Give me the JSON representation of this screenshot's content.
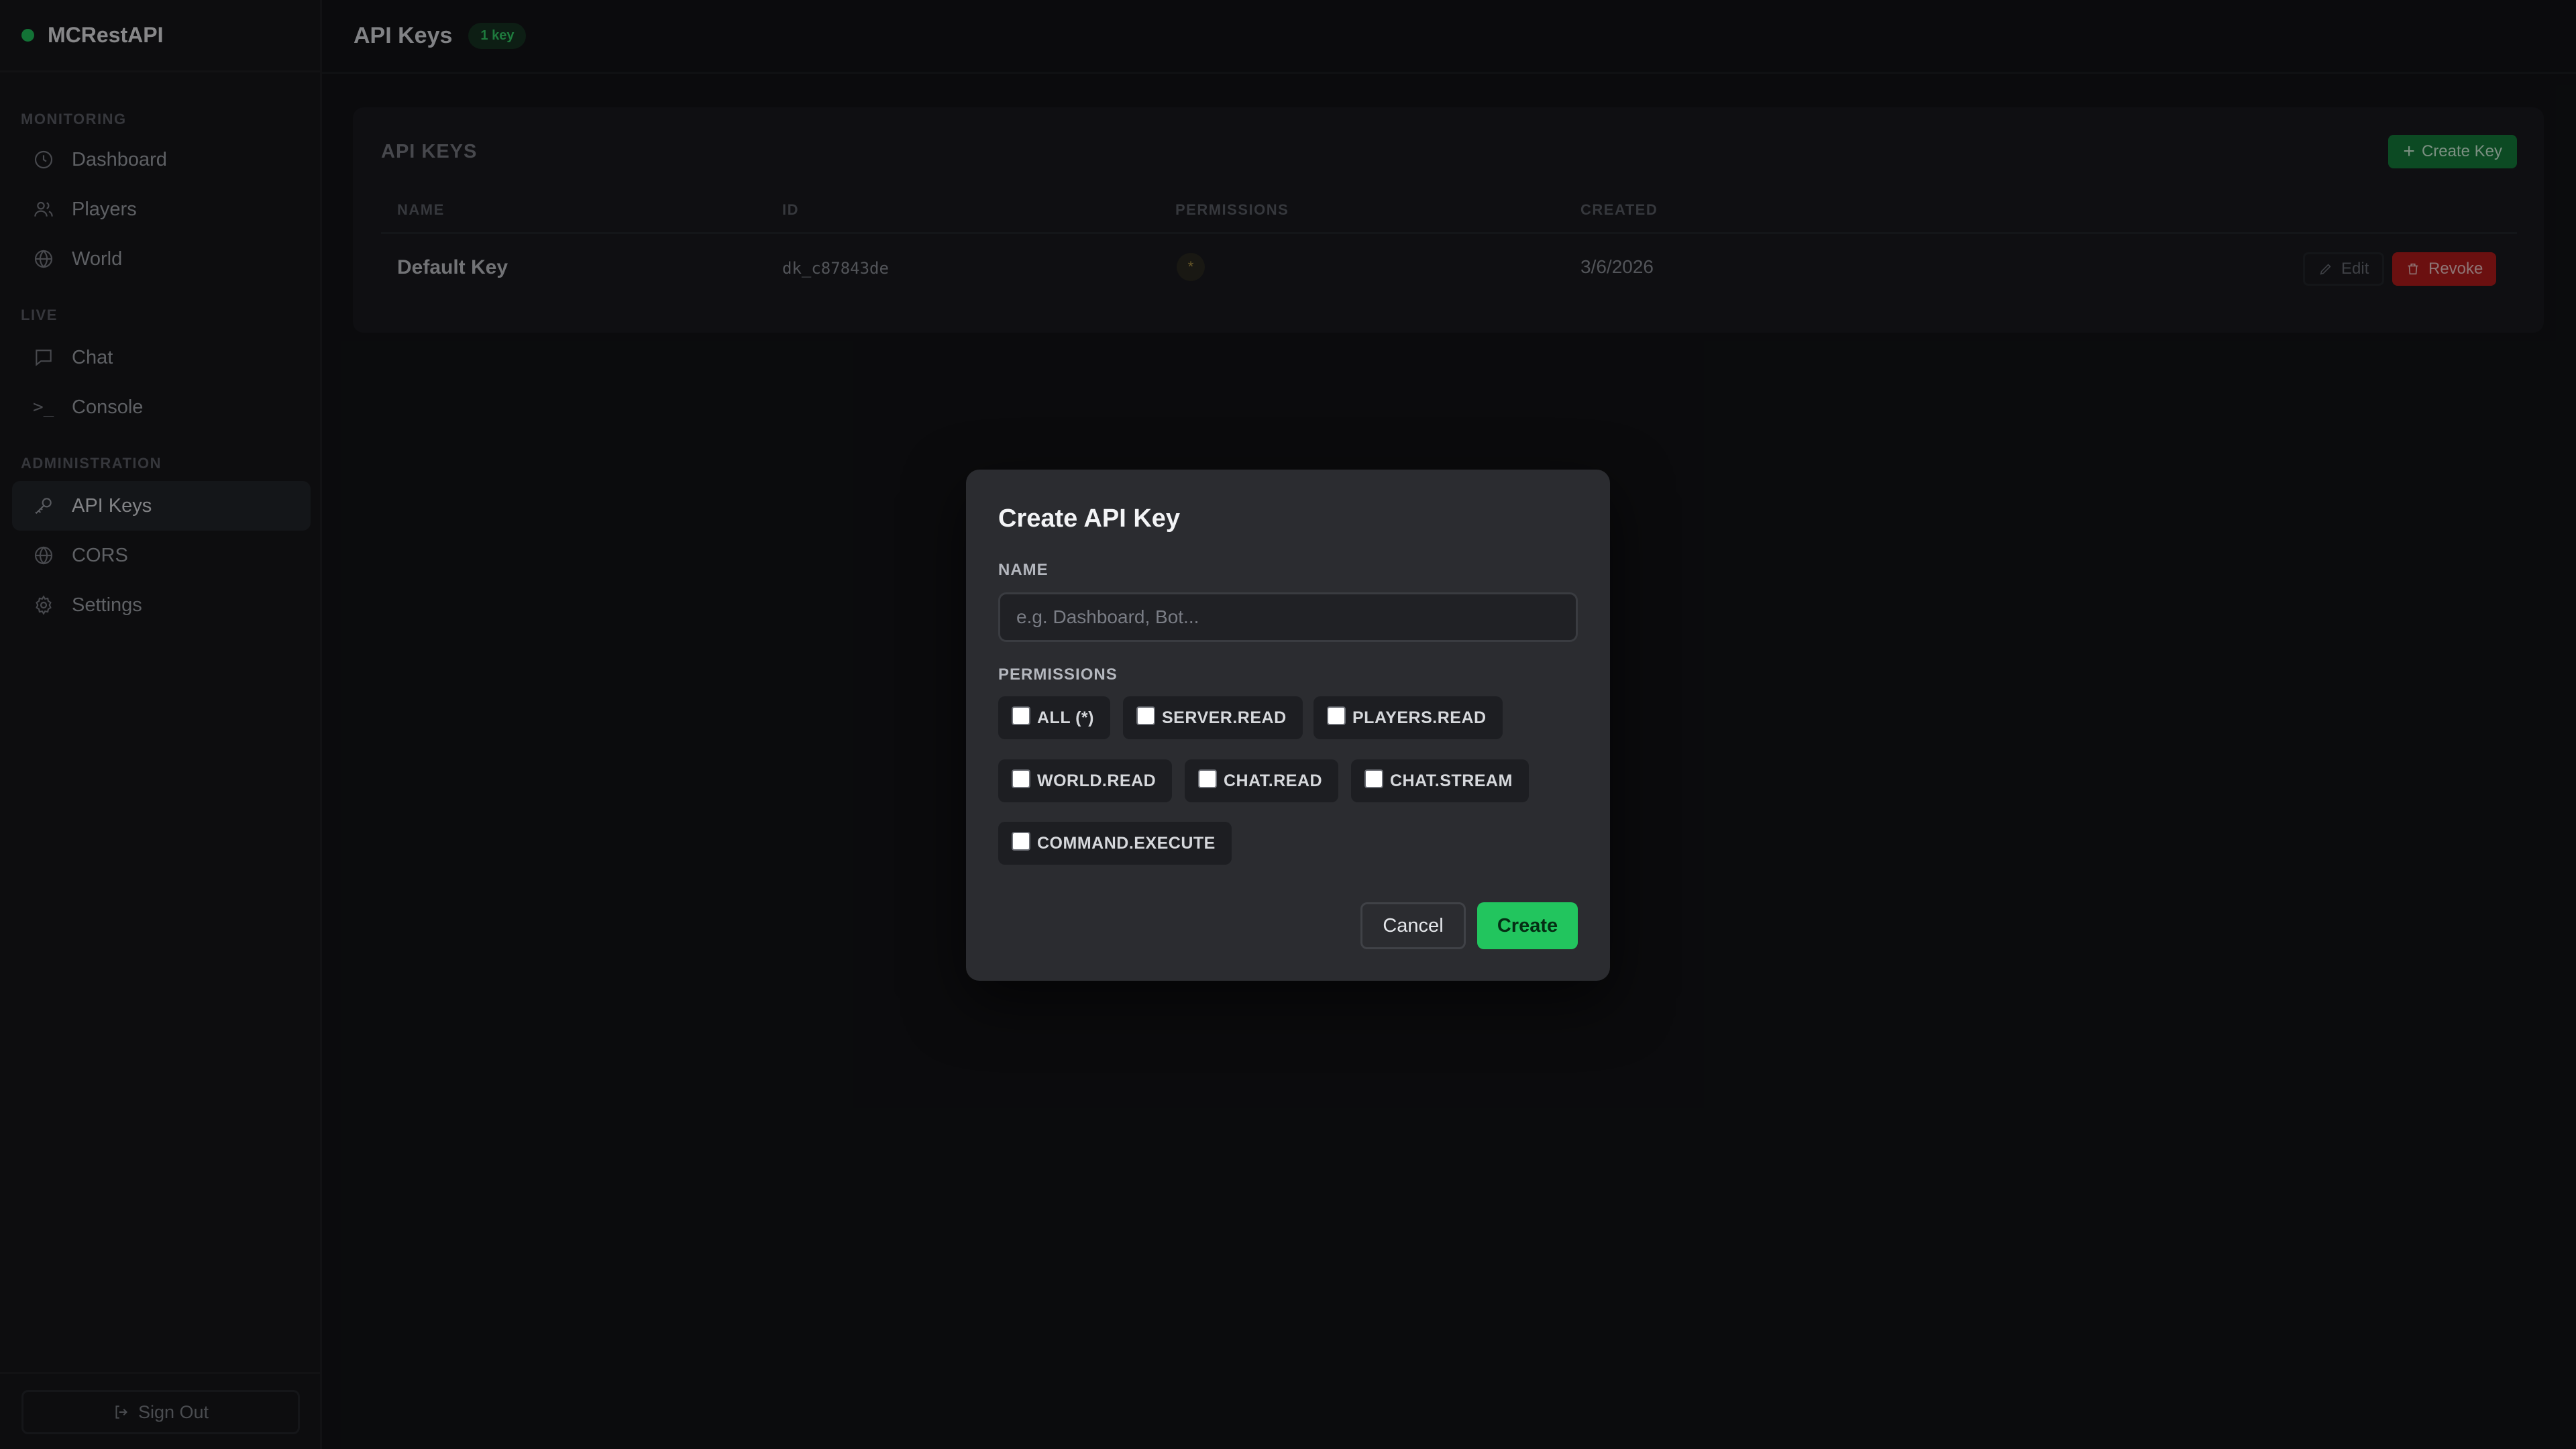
{
  "app": {
    "name": "MCRestAPI",
    "status_color": "#22c55e"
  },
  "sidebar": {
    "sections": [
      {
        "label": "MONITORING"
      },
      {
        "label": "LIVE"
      },
      {
        "label": "ADMINISTRATION"
      }
    ],
    "items": [
      {
        "label": "Dashboard",
        "icon": "clock-icon"
      },
      {
        "label": "Players",
        "icon": "users-icon"
      },
      {
        "label": "World",
        "icon": "globe-icon"
      },
      {
        "label": "Chat",
        "icon": "chat-icon"
      },
      {
        "label": "Console",
        "icon": "terminal-icon",
        "glyph": ">_"
      },
      {
        "label": "API Keys",
        "icon": "key-icon",
        "active": true
      },
      {
        "label": "CORS",
        "icon": "globe-icon"
      },
      {
        "label": "Settings",
        "icon": "gear-icon"
      }
    ],
    "sign_out": "Sign Out"
  },
  "header": {
    "title": "API Keys",
    "badge": "1 key"
  },
  "panel": {
    "title": "API KEYS",
    "create_button": "Create Key",
    "columns": [
      "NAME",
      "ID",
      "PERMISSIONS",
      "CREATED"
    ],
    "rows": [
      {
        "name": "Default Key",
        "id": "dk_c87843de",
        "permissions": "*",
        "created": "3/6/2026"
      }
    ],
    "edit_label": "Edit",
    "revoke_label": "Revoke"
  },
  "modal": {
    "title": "Create API Key",
    "name_label": "NAME",
    "name_value": "",
    "name_placeholder": "e.g. Dashboard, Bot...",
    "permissions_label": "PERMISSIONS",
    "permissions": [
      {
        "label": "ALL (*)",
        "checked": false
      },
      {
        "label": "SERVER.READ",
        "checked": false
      },
      {
        "label": "PLAYERS.READ",
        "checked": false
      },
      {
        "label": "WORLD.READ",
        "checked": false
      },
      {
        "label": "CHAT.READ",
        "checked": false
      },
      {
        "label": "CHAT.STREAM",
        "checked": false
      },
      {
        "label": "COMMAND.EXECUTE",
        "checked": false
      }
    ],
    "cancel_label": "Cancel",
    "create_label": "Create"
  }
}
